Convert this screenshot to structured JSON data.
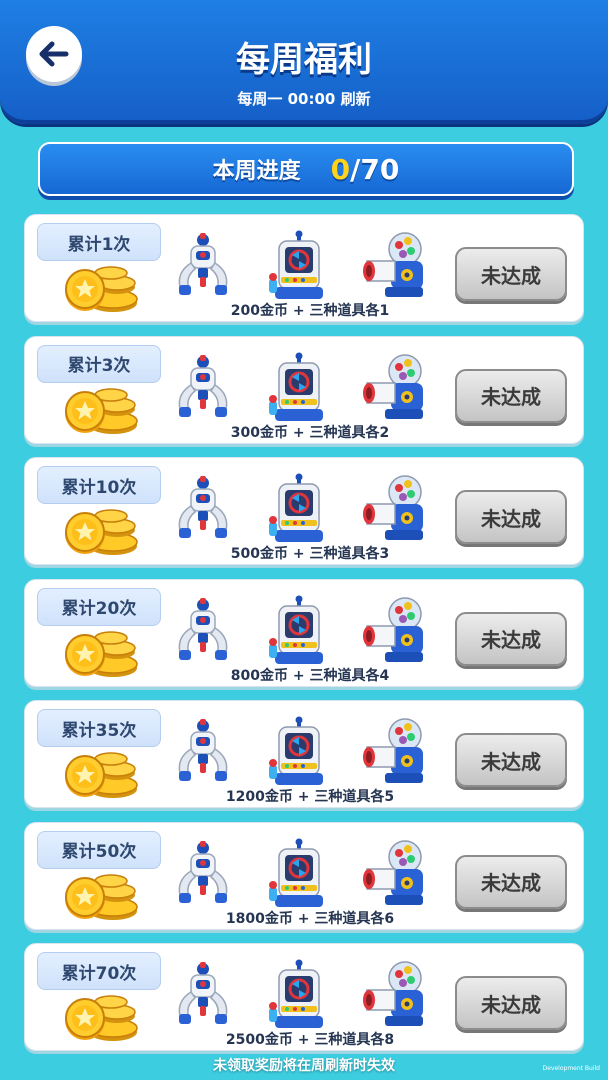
{
  "header": {
    "title": "每周福利",
    "subtitle": "每周一 00:00 刷新",
    "back_icon": "arrow-left-icon"
  },
  "progress": {
    "label": "本周进度",
    "current": "0",
    "total": "/70"
  },
  "tiers": [
    {
      "badge": "累计1次",
      "reward": "200金币 + 三种道具各1",
      "status": "未达成"
    },
    {
      "badge": "累计3次",
      "reward": "300金币 + 三种道具各2",
      "status": "未达成"
    },
    {
      "badge": "累计10次",
      "reward": "500金币 + 三种道具各3",
      "status": "未达成"
    },
    {
      "badge": "累计20次",
      "reward": "800金币 + 三种道具各4",
      "status": "未达成"
    },
    {
      "badge": "累计35次",
      "reward": "1200金币 + 三种道具各5",
      "status": "未达成"
    },
    {
      "badge": "累计50次",
      "reward": "1800金币 + 三种道具各6",
      "status": "未达成"
    },
    {
      "badge": "累计70次",
      "reward": "2500金币 + 三种道具各8",
      "status": "未达成"
    }
  ],
  "items": [
    "claw-robot-icon",
    "arcade-machine-icon",
    "ball-cannon-icon"
  ],
  "footer": {
    "note": "未领取奖励将在周刷新时失效",
    "dev_build": "Development Build"
  },
  "colors": {
    "background": "#3ccde0",
    "header": "#1f7fe4",
    "progress_current": "#ffd21e",
    "button_disabled": "#c4c4c4"
  }
}
